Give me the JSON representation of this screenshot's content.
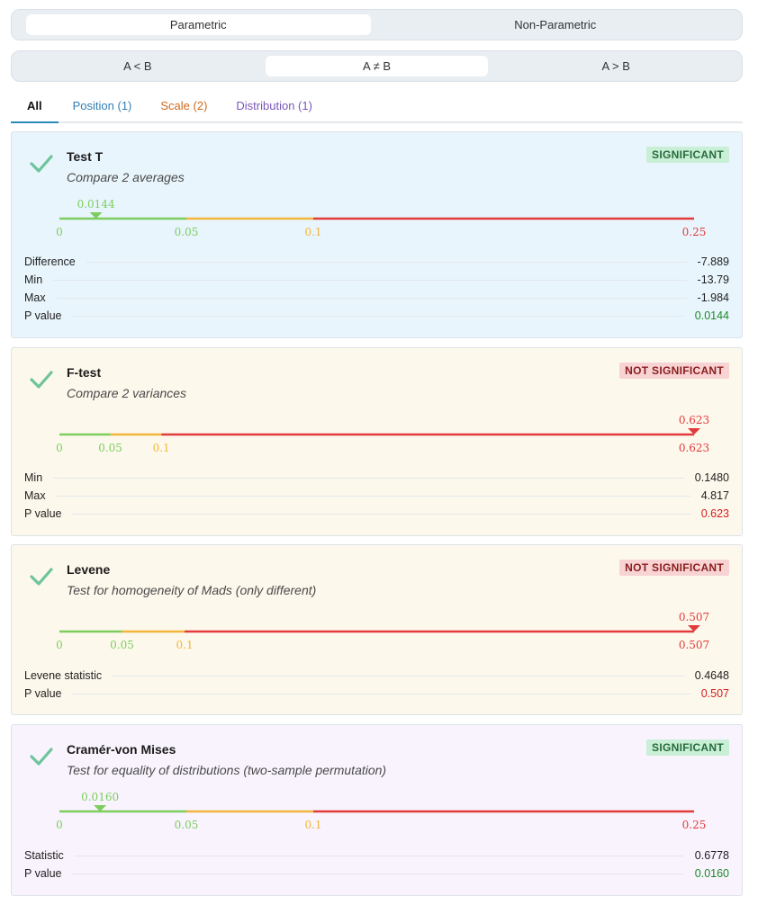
{
  "mode": {
    "options": [
      "Parametric",
      "Non-Parametric"
    ],
    "active": 0
  },
  "direction": {
    "options": [
      "A < B",
      "A ≠ B",
      "A > B"
    ],
    "active": 1
  },
  "tabs": [
    {
      "label": "All",
      "color": "#111111"
    },
    {
      "label": "Position (1)",
      "color": "#2f7fb5"
    },
    {
      "label": "Scale (2)",
      "color": "#d0691c"
    },
    {
      "label": "Distribution (1)",
      "color": "#7a57b8"
    }
  ],
  "colors": {
    "green": "#7ccd5e",
    "orange": "#f2b63c",
    "red": "#e23b3b",
    "check": "#6ec49b",
    "val_green": "#1f8a2a",
    "val_red": "#d41c1c"
  },
  "cards": [
    {
      "title": "Test T",
      "subtitle": "Compare 2 averages",
      "badge": "SIGNIFICANT",
      "significant": true,
      "bg": "#e8f5fc",
      "scale": {
        "max": 0.25,
        "value": 0.0144,
        "value_label": "0.0144",
        "ticks": [
          "0",
          "0.05",
          "0.1",
          "0.25"
        ]
      },
      "rows": [
        {
          "label": "Difference",
          "value": "-7.889"
        },
        {
          "label": "Min",
          "value": "-13.79"
        },
        {
          "label": "Max",
          "value": "-1.984"
        },
        {
          "label": "P value",
          "value": "0.0144",
          "p": true
        }
      ]
    },
    {
      "title": "F-test",
      "subtitle": "Compare 2 variances",
      "badge": "NOT SIGNIFICANT",
      "significant": false,
      "bg": "#fdf8ec",
      "scale": {
        "max": 0.623,
        "value": 0.623,
        "value_label": "0.623",
        "ticks": [
          "0",
          "0.05",
          "0.1",
          "0.623"
        ]
      },
      "rows": [
        {
          "label": "Min",
          "value": "0.1480"
        },
        {
          "label": "Max",
          "value": "4.817"
        },
        {
          "label": "P value",
          "value": "0.623",
          "p": true
        }
      ]
    },
    {
      "title": "Levene",
      "subtitle": "Test for homogeneity of Mads (only different)",
      "badge": "NOT SIGNIFICANT",
      "significant": false,
      "bg": "#fdf8ec",
      "scale": {
        "max": 0.507,
        "value": 0.507,
        "value_label": "0.507",
        "ticks": [
          "0",
          "0.05",
          "0.1",
          "0.507"
        ]
      },
      "rows": [
        {
          "label": "Levene statistic",
          "value": "0.4648"
        },
        {
          "label": "P value",
          "value": "0.507",
          "p": true
        }
      ]
    },
    {
      "title": "Cramér-von Mises",
      "subtitle": "Test for equality of distributions (two-sample permutation)",
      "badge": "SIGNIFICANT",
      "significant": true,
      "bg": "#f8f3fc",
      "scale": {
        "max": 0.25,
        "value": 0.016,
        "value_label": "0.0160",
        "ticks": [
          "0",
          "0.05",
          "0.1",
          "0.25"
        ]
      },
      "rows": [
        {
          "label": "Statistic",
          "value": "0.6778"
        },
        {
          "label": "P value",
          "value": "0.0160",
          "p": true
        }
      ]
    }
  ]
}
